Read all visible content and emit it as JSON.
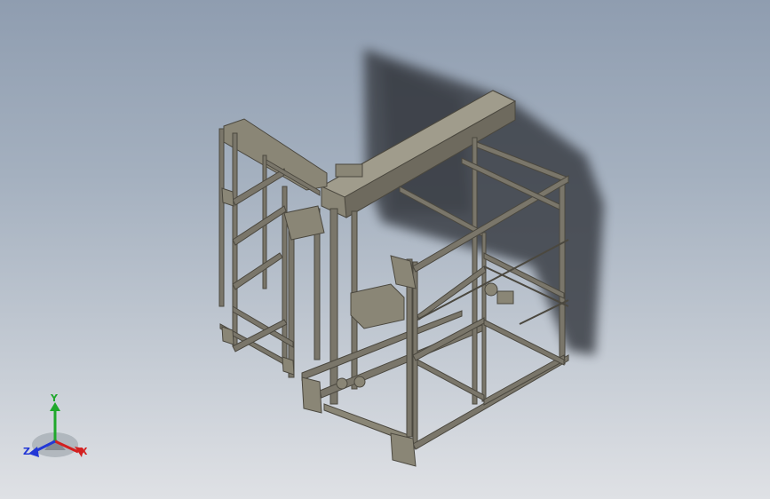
{
  "viewport": {
    "background_top": "#8f9db0",
    "background_bottom": "#dfe1e5",
    "model_color": "#6e6a5e",
    "model_face": "#8a8676",
    "shadow_color": "#3a3e45"
  },
  "triad": {
    "x_label": "X",
    "y_label": "Y",
    "z_label": "Z",
    "x_color": "#d32020",
    "y_color": "#1fa82b",
    "z_color": "#2338d6"
  }
}
